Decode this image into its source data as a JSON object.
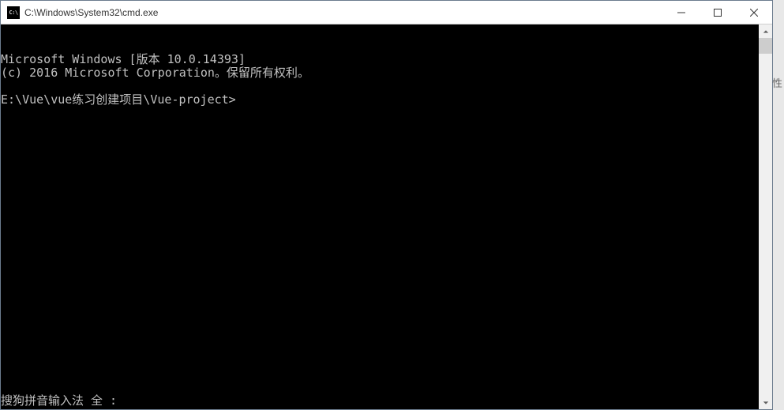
{
  "window": {
    "title": "C:\\Windows\\System32\\cmd.exe",
    "icon_text": "C:\\"
  },
  "terminal": {
    "lines": [
      "Microsoft Windows [版本 10.0.14393]",
      "(c) 2016 Microsoft Corporation。保留所有权利。",
      "",
      "E:\\Vue\\vue练习创建项目\\Vue-project>"
    ],
    "ime_status": "搜狗拼音输入法 全 :"
  },
  "right_panel": {
    "char": "性"
  }
}
